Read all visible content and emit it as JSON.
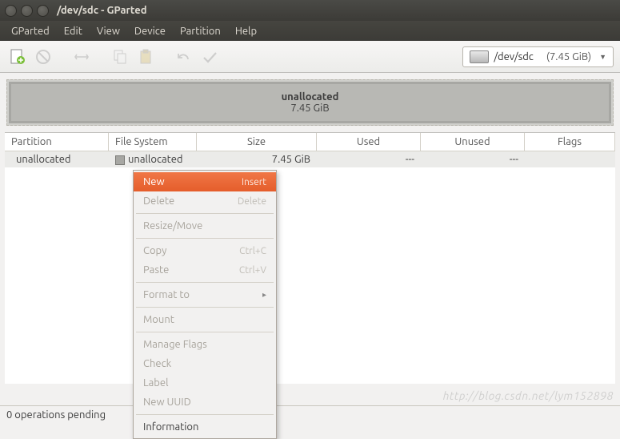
{
  "window": {
    "title": "/dev/sdc - GParted"
  },
  "menubar": {
    "items": [
      "GParted",
      "Edit",
      "View",
      "Device",
      "Partition",
      "Help"
    ]
  },
  "device_selector": {
    "device": "/dev/sdc",
    "capacity": "(7.45 GiB)"
  },
  "graph": {
    "label": "unallocated",
    "size": "7.45 GiB"
  },
  "table": {
    "headers": {
      "partition": "Partition",
      "filesystem": "File System",
      "size": "Size",
      "used": "Used",
      "unused": "Unused",
      "flags": "Flags"
    },
    "rows": [
      {
        "partition": "unallocated",
        "filesystem": "unallocated",
        "size": "7.45 GiB",
        "used": "---",
        "unused": "---",
        "flags": ""
      }
    ]
  },
  "context_menu": {
    "new": {
      "label": "New",
      "accel": "Insert"
    },
    "delete": {
      "label": "Delete",
      "accel": "Delete"
    },
    "resize": {
      "label": "Resize/Move"
    },
    "copy": {
      "label": "Copy",
      "accel": "Ctrl+C"
    },
    "paste": {
      "label": "Paste",
      "accel": "Ctrl+V"
    },
    "format": {
      "label": "Format to"
    },
    "mount": {
      "label": "Mount"
    },
    "manage_flags": {
      "label": "Manage Flags"
    },
    "check": {
      "label": "Check"
    },
    "label": {
      "label": "Label"
    },
    "new_uuid": {
      "label": "New UUID"
    },
    "information": {
      "label": "Information"
    }
  },
  "statusbar": {
    "text": "0 operations pending"
  },
  "watermark": "http://blog.csdn.net/lym152898"
}
